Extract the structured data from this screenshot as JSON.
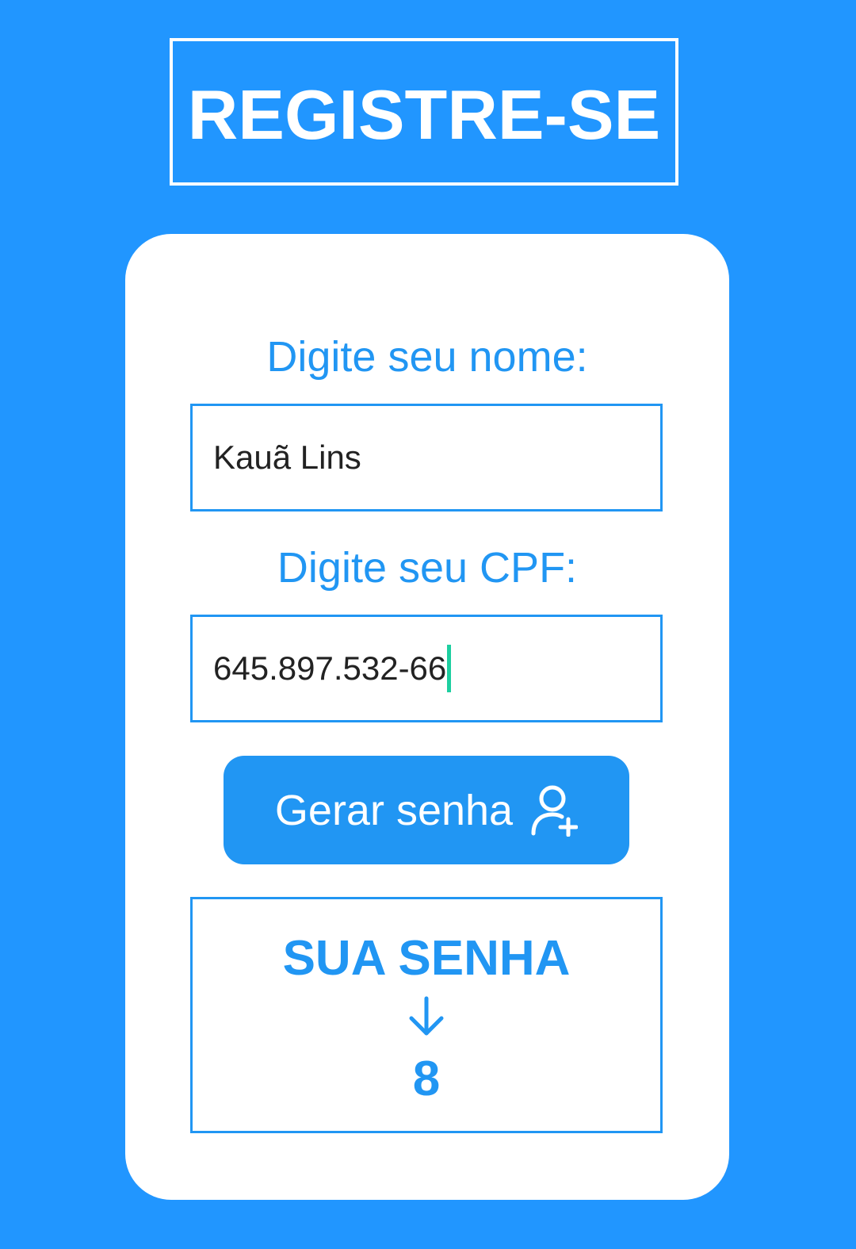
{
  "header": {
    "title": "REGISTRE-SE"
  },
  "form": {
    "name_label": "Digite seu nome:",
    "name_value": "Kauã Lins",
    "cpf_label": "Digite seu CPF:",
    "cpf_value": "645.897.532-66",
    "generate_button_label": "Gerar senha",
    "generate_button_icon": "user-plus-icon"
  },
  "result": {
    "title": "SUA SENHA",
    "arrow_icon": "arrow-down-icon",
    "value": "8"
  },
  "colors": {
    "background": "#2196FF",
    "accent": "#2196F3",
    "card": "#FFFFFF",
    "caret": "#1DCFA0"
  }
}
